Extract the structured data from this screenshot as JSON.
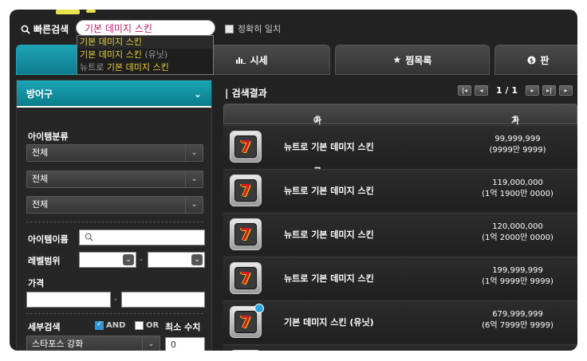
{
  "search": {
    "label": "빠른검색",
    "query": "기본 데미지 스킨",
    "exact_label": "정확히 일치",
    "autocomplete": [
      {
        "main": "기본 데미지 스킨",
        "suffix": "",
        "prefix": ""
      },
      {
        "main": "기본 데미지 스킨",
        "suffix": " (유닛)",
        "prefix": ""
      },
      {
        "main": "기본 데미지 스킨",
        "suffix": "",
        "prefix": "뉴트로 "
      }
    ]
  },
  "tabs": [
    {
      "label": "",
      "icon": "search-icon",
      "active": true
    },
    {
      "label": "시세",
      "icon": "bar-chart-icon",
      "active": false
    },
    {
      "label": "찜목록",
      "icon": "star-icon",
      "active": false
    },
    {
      "label": "판",
      "icon": "coin-icon",
      "active": false
    }
  ],
  "filter": {
    "category_title": "방어구",
    "item_class_label": "아이템분류",
    "selects": [
      "전체",
      "전체",
      "전체"
    ],
    "item_name_label": "아이템이름",
    "level_label": "레벨범위",
    "price_label": "가격",
    "detail_label": "세부검색",
    "and_label": "AND",
    "or_label": "OR",
    "min_label": "최소 수치",
    "detail_select": "스타포스 강화",
    "detail_value": "0"
  },
  "results": {
    "title": "검색결과",
    "page_current": "1",
    "page_total": "1",
    "col_name": "아이템 이름",
    "col_price": "가격",
    "rows": [
      {
        "name": "뉴트로 기본 데미지 스킨",
        "price": "99,999,999",
        "price_kr": "(9999만 9999)",
        "badge": false
      },
      {
        "name": "뉴트로 기본 데미지 스킨",
        "price": "119,000,000",
        "price_kr": "(1억 1900만 0000)",
        "badge": false
      },
      {
        "name": "뉴트로 기본 데미지 스킨",
        "price": "120,000,000",
        "price_kr": "(1억 2000만 0000)",
        "badge": false
      },
      {
        "name": "뉴트로 기본 데미지 스킨",
        "price": "199,999,999",
        "price_kr": "(1억 9999만 9999)",
        "badge": false
      },
      {
        "name": "기본 데미지 스킨 (유닛)",
        "price": "679,999,999",
        "price_kr": "(6억 7999만 9999)",
        "badge": true
      }
    ]
  },
  "colors": {
    "accent": "#1aa5b5",
    "highlight": "#e8d23a",
    "query": "#c0186a"
  }
}
